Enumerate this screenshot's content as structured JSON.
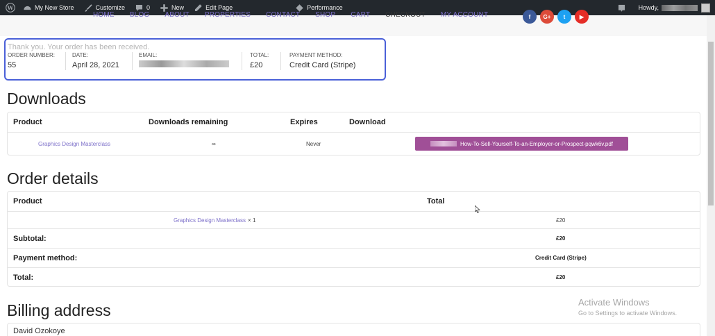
{
  "adminbar": {
    "site_name": "My New Store",
    "customize": "Customize",
    "comments_count": "0",
    "new_label": "New",
    "edit_page": "Edit Page",
    "performance": "Performance",
    "howdy": "Howdy,"
  },
  "nav": {
    "items": [
      "HOME",
      "BLOG",
      "ABOUT",
      "PROPERTIES",
      "CONTACT",
      "SHOP",
      "CART",
      "CHECKOUT",
      "MY ACCOUNT"
    ],
    "active": "CHECKOUT"
  },
  "socials": [
    {
      "icon": "facebook-icon",
      "glyph": "f",
      "color": "#3b5998"
    },
    {
      "icon": "google-plus-icon",
      "glyph": "G+",
      "color": "#dd4b39"
    },
    {
      "icon": "twitter-icon",
      "glyph": "t",
      "color": "#1da1f2"
    },
    {
      "icon": "youtube-icon",
      "glyph": "▶",
      "color": "#e52d27"
    }
  ],
  "overview": {
    "thanks": "Thank you. Your order has been received.",
    "order_number_label": "ORDER NUMBER:",
    "order_number": "55",
    "date_label": "DATE:",
    "date": "April 28, 2021",
    "email_label": "EMAIL:",
    "total_label": "TOTAL:",
    "total": "£20",
    "payment_label": "PAYMENT METHOD:",
    "payment": "Credit Card (Stripe)"
  },
  "downloads": {
    "title": "Downloads",
    "headers": [
      "Product",
      "Downloads remaining",
      "Expires",
      "Download"
    ],
    "row": {
      "product": "Graphics Design Masterclass",
      "remaining": "∞",
      "expires": "Never",
      "file": "How-To-Sell-Yourself-To-an-Employer-or-Prospect-pqwk6v.pdf"
    }
  },
  "order_details": {
    "title": "Order details",
    "headers": [
      "Product",
      "Total"
    ],
    "item": {
      "product": "Graphics Design Masterclass",
      "qty": "× 1",
      "total": "£20"
    },
    "subtotal_label": "Subtotal:",
    "subtotal": "£20",
    "payment_label": "Payment method:",
    "payment": "Credit Card (Stripe)",
    "total_label": "Total:",
    "total": "£20"
  },
  "billing": {
    "title": "Billing address",
    "name": "David Ozokoye"
  },
  "watermark": {
    "line1": "Activate Windows",
    "line2": "Go to Settings to activate Windows."
  },
  "colors": {
    "accent": "#7c6fc9",
    "download_button": "#a04f97",
    "overview_border": "#4a60d8",
    "adminbar": "#23282d"
  }
}
